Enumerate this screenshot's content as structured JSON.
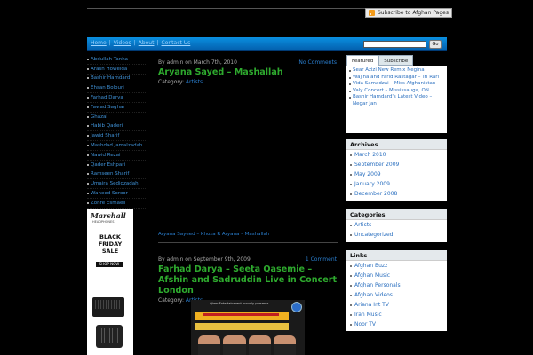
{
  "header": {
    "subscribe_label": "Subscribe to Afghan Pages"
  },
  "nav": {
    "links": [
      "Home",
      "Videos",
      "About",
      "Contact Us"
    ],
    "search_button": "Go"
  },
  "left_menu": [
    "Abdullah Tanha",
    "Arash Howeida",
    "Bashir Hamdard",
    "Ehsan Bolouri",
    "Farhad Darya",
    "Fawad Saghar",
    "Ghazal",
    "Habib Qaderi",
    "Jawid Sharif",
    "Mashdad Jamalzadah",
    "Nawid Rezai",
    "Qader Eshpari",
    "Ramseen Sharif",
    "Umaira Sediqzadah",
    "Waheed Soroor",
    "Zohre Esmaeli"
  ],
  "ad": {
    "brand": "Marshall",
    "brand_sub": "HEADPHONES",
    "headline": [
      "BLACK",
      "FRIDAY",
      "SALE"
    ],
    "cta": "SHOP NOW"
  },
  "posts": [
    {
      "meta": "By admin on March 7th, 2010",
      "comments": "No Comments",
      "title": "Aryana Sayed – Mashallah",
      "category_label": "Category:",
      "category": "Artists",
      "video_caption": "Aryana Sayeed – Khoza R Aryana – Mashallah"
    },
    {
      "meta": "By admin on September 9th, 2009",
      "comments": "1 Comment",
      "title": "Farhad Darya – Seeta Qasemie – Afshin and Sadruddin Live in Concert London",
      "category_label": "Category:",
      "category": "Artists",
      "poster_text": "Qiam Entertainment proudly presents..."
    }
  ],
  "sidebar": {
    "tabs": [
      "Featured",
      "Subscribe"
    ],
    "featured": [
      "Sear Azizi New Remix Negina",
      "Wajiha and Farid Rastagar – Tri Rari",
      "Vida Samadzai – Miss Afghanistan",
      "Valy Concert – Mississauga, ON",
      "Bashir Hamdard's Latest Video – Negar Jan"
    ],
    "archives_title": "Archives",
    "archives": [
      "March 2010",
      "September 2009",
      "May 2009",
      "January 2009",
      "December 2008"
    ],
    "categories_title": "Categories",
    "categories": [
      "Artists",
      "Uncategorized"
    ],
    "links_title": "Links",
    "links": [
      "Afghan Buzz",
      "Afghan Music",
      "Afghan Personals",
      "Afghan Videos",
      "Ariana Int TV",
      "Iran Music",
      "Noor TV"
    ]
  }
}
